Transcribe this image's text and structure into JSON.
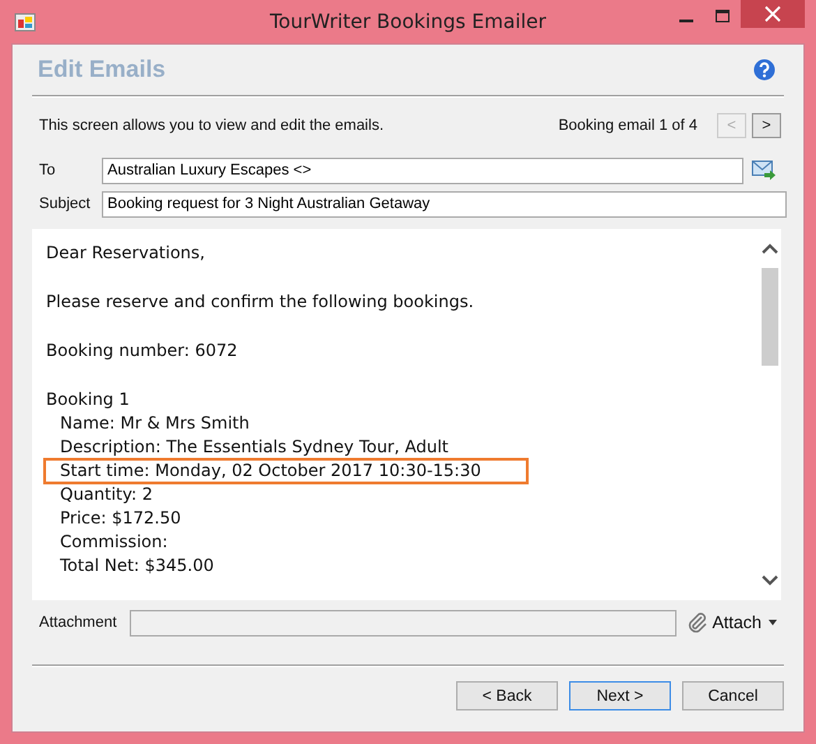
{
  "window": {
    "title": "TourWriter Bookings Emailer"
  },
  "header": {
    "title": "Edit Emails"
  },
  "description": "This screen allows you to view and edit the emails.",
  "pager": {
    "label": "Booking email 1 of 4",
    "prev": {
      "label": "<",
      "disabled": true
    },
    "next": {
      "label": ">",
      "disabled": false
    }
  },
  "fields": [
    {
      "label": "To",
      "value": "Australian Luxury Escapes <>"
    },
    {
      "label": "Subject",
      "value": "Booking request for 3 Night Australian Getaway"
    }
  ],
  "email": {
    "paragraphs": [
      "Dear Reservations,",
      "Please reserve and confirm the following bookings.",
      "Booking number: 6072"
    ],
    "bookings": [
      {
        "title": "Booking 1",
        "children": [
          {
            "text": "Name: Mr & Mrs Smith",
            "highlighted": false
          },
          {
            "text": "Description: The Essentials Sydney Tour, Adult",
            "highlighted": false
          },
          {
            "text": "Start time: Monday, 02 October 2017 10:30-15:30",
            "highlighted": true
          },
          {
            "text": "Quantity: 2",
            "highlighted": false
          },
          {
            "text": "Price: $172.50",
            "highlighted": false
          },
          {
            "text": "Commission:",
            "highlighted": false
          },
          {
            "text": "Total Net: $345.00",
            "highlighted": false
          }
        ]
      }
    ]
  },
  "attachment": {
    "label": "Attachment",
    "button": "Attach"
  },
  "buttons": [
    {
      "label": "< Back",
      "selected": false
    },
    {
      "label": "Next >",
      "selected": true
    },
    {
      "label": "Cancel",
      "selected": false
    }
  ]
}
